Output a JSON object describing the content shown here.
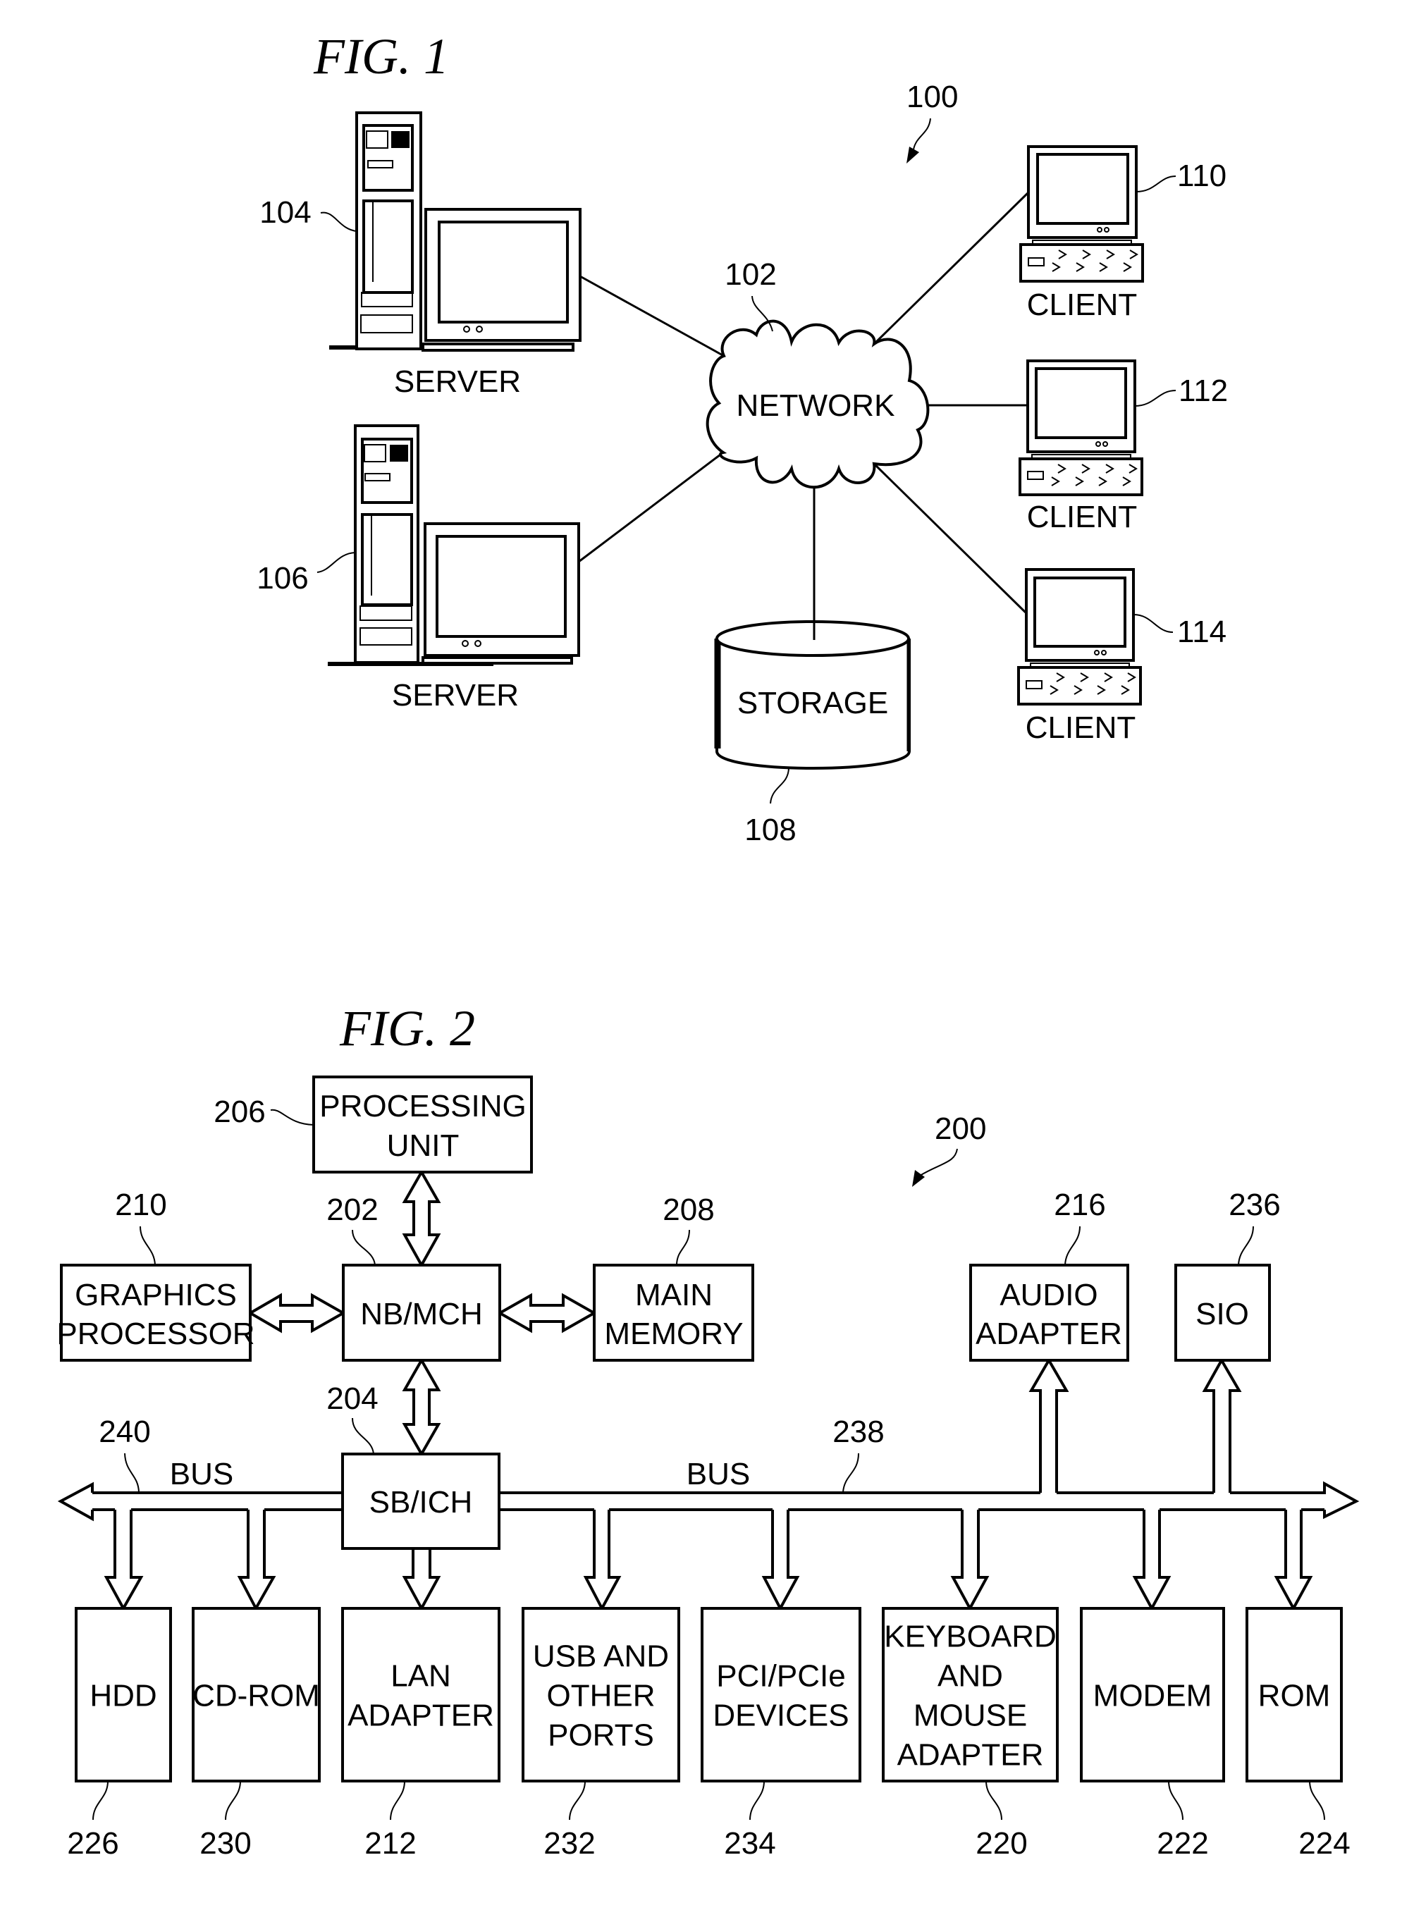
{
  "fig1": {
    "title": "FIG. 1",
    "system_ref": "100",
    "network": {
      "ref": "102",
      "label": "NETWORK"
    },
    "servers": [
      {
        "ref": "104",
        "label": "SERVER"
      },
      {
        "ref": "106",
        "label": "SERVER"
      }
    ],
    "storage": {
      "ref": "108",
      "label": "STORAGE"
    },
    "clients": [
      {
        "ref": "110",
        "label": "CLIENT"
      },
      {
        "ref": "112",
        "label": "CLIENT"
      },
      {
        "ref": "114",
        "label": "CLIENT"
      }
    ]
  },
  "fig2": {
    "title": "FIG. 2",
    "system_ref": "200",
    "top_boxes": {
      "processing_unit": {
        "ref": "206",
        "lines": [
          "PROCESSING",
          "UNIT"
        ]
      },
      "graphics_processor": {
        "ref": "210",
        "lines": [
          "GRAPHICS",
          "PROCESSOR"
        ]
      },
      "nb_mch": {
        "ref": "202",
        "lines": [
          "NB/MCH"
        ]
      },
      "main_memory": {
        "ref": "208",
        "lines": [
          "MAIN",
          "MEMORY"
        ]
      },
      "audio_adapter": {
        "ref": "216",
        "lines": [
          "AUDIO",
          "ADAPTER"
        ]
      },
      "sio": {
        "ref": "236",
        "lines": [
          "SIO"
        ]
      },
      "sb_ich": {
        "ref": "204",
        "lines": [
          "SB/ICH"
        ]
      }
    },
    "buses": [
      {
        "ref": "240",
        "label": "BUS"
      },
      {
        "ref": "238",
        "label": "BUS"
      }
    ],
    "bottom_boxes": [
      {
        "ref": "226",
        "lines": [
          "HDD"
        ]
      },
      {
        "ref": "230",
        "lines": [
          "CD-ROM"
        ]
      },
      {
        "ref": "212",
        "lines": [
          "LAN",
          "ADAPTER"
        ]
      },
      {
        "ref": "232",
        "lines": [
          "USB AND",
          "OTHER",
          "PORTS"
        ]
      },
      {
        "ref": "234",
        "lines": [
          "PCI/PCIe",
          "DEVICES"
        ]
      },
      {
        "ref": "220",
        "lines": [
          "KEYBOARD",
          "AND",
          "MOUSE",
          "ADAPTER"
        ]
      },
      {
        "ref": "222",
        "lines": [
          "MODEM"
        ]
      },
      {
        "ref": "224",
        "lines": [
          "ROM"
        ]
      }
    ]
  }
}
